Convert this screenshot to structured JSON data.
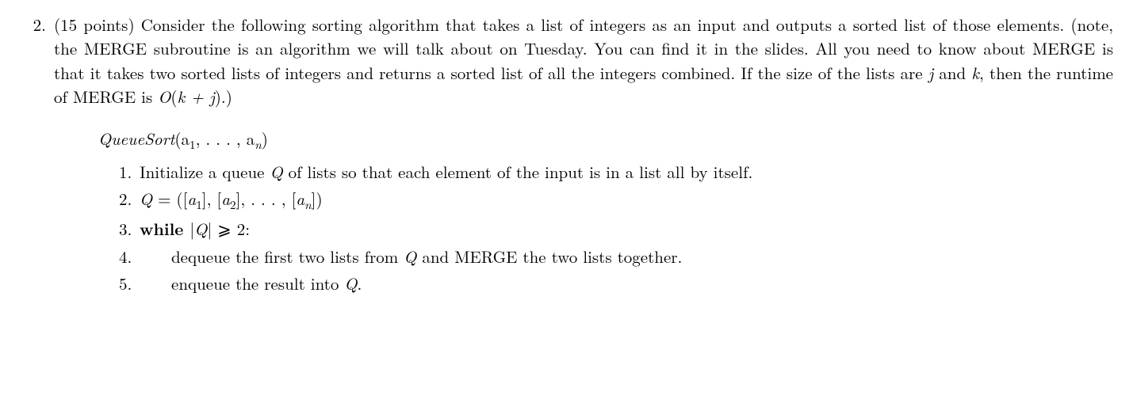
{
  "problem": {
    "number": "2.",
    "points": "(15 points)",
    "intro_part1": " Consider the following sorting algorithm that takes a list of integers as an input and outputs a sorted list of those elements. (note, the MERGE subroutine is an algorithm we will talk about on Tuesday. You can find it in the slides. All you need to know about MERGE is that it takes two sorted lists of integers and returns a sorted list of all the integers combined. If the size of the lists are ",
    "intro_var_j": "j",
    "intro_and": " and ",
    "intro_var_k": "k",
    "intro_part2": ", then the runtime of MERGE is ",
    "intro_bigO": "O",
    "intro_paren_open": "(",
    "intro_kplusj": "k + j",
    "intro_paren_close": ").)"
  },
  "algo": {
    "title_name": "QueueSort",
    "title_args": "(a",
    "title_sub1": "1",
    "title_comma": ", . . . , a",
    "title_subn": "n",
    "title_close": ")",
    "steps": [
      {
        "num": "1.",
        "text_a": "Initialize a queue ",
        "q": "Q",
        "text_b": " of lists so that each element of the input is in a list all by itself."
      },
      {
        "num": "2.",
        "q": "Q",
        "eq": " = ([",
        "a": "a",
        "s1": "1",
        "mid1": "], [",
        "s2": "2",
        "mid2": "], . . . , [",
        "sn": "n",
        "end": "])"
      },
      {
        "num": "3.",
        "while": "while ",
        "bar1": "|",
        "q": "Q",
        "bar2": "| ⩾ 2:"
      },
      {
        "num": "4.",
        "text_a": "dequeue the first two lists from ",
        "q": "Q",
        "text_b": " and MERGE the two lists together."
      },
      {
        "num": "5.",
        "text_a": "enqueue the result into ",
        "q": "Q",
        "text_b": "."
      }
    ]
  }
}
